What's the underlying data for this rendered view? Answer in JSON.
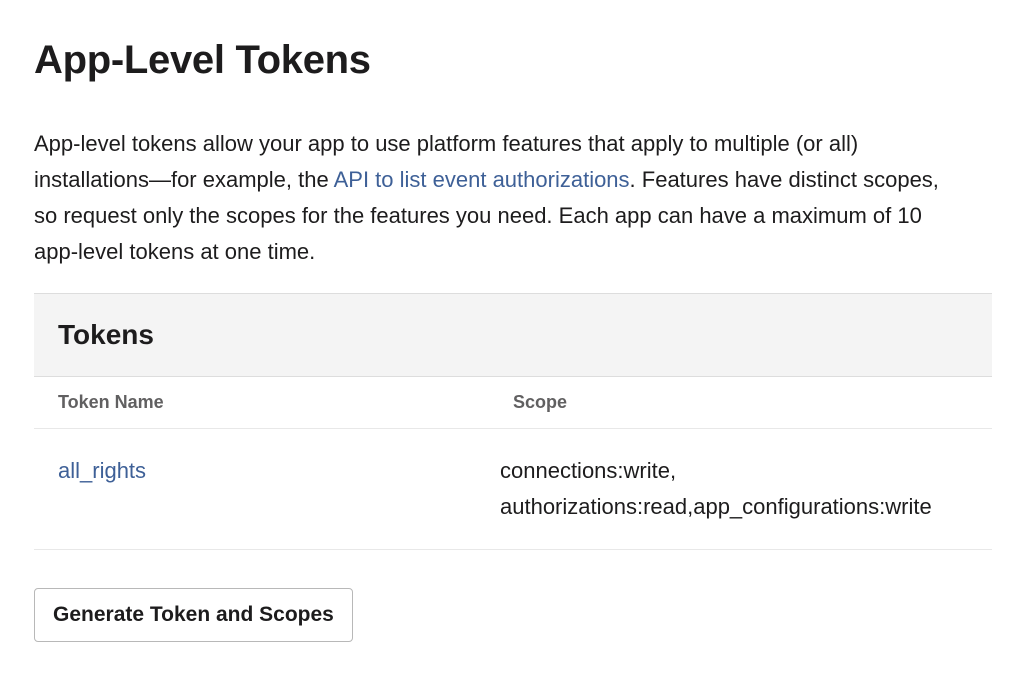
{
  "page": {
    "title": "App-Level Tokens"
  },
  "intro": {
    "text_before_link": "App-level tokens allow your app to use platform features that apply to multiple (or all) installations—for example, the ",
    "link_text": "API to list event authorizations",
    "text_after_link": ". Features have distinct scopes, so request only the scopes for the features you need. Each app can have a maximum of 10 app-level tokens at one time."
  },
  "tokens": {
    "title": "Tokens",
    "columns": {
      "name": "Token Name",
      "scope": "Scope"
    },
    "rows": [
      {
        "name": "all_rights",
        "scope": "connections:write, authorizations:read,app_configurations:write"
      }
    ]
  },
  "actions": {
    "generate_label": "Generate Token and Scopes"
  },
  "colors": {
    "link": "#3e6097",
    "text": "#1d1c1d",
    "header_bg": "#f4f4f4",
    "muted": "#616061"
  }
}
